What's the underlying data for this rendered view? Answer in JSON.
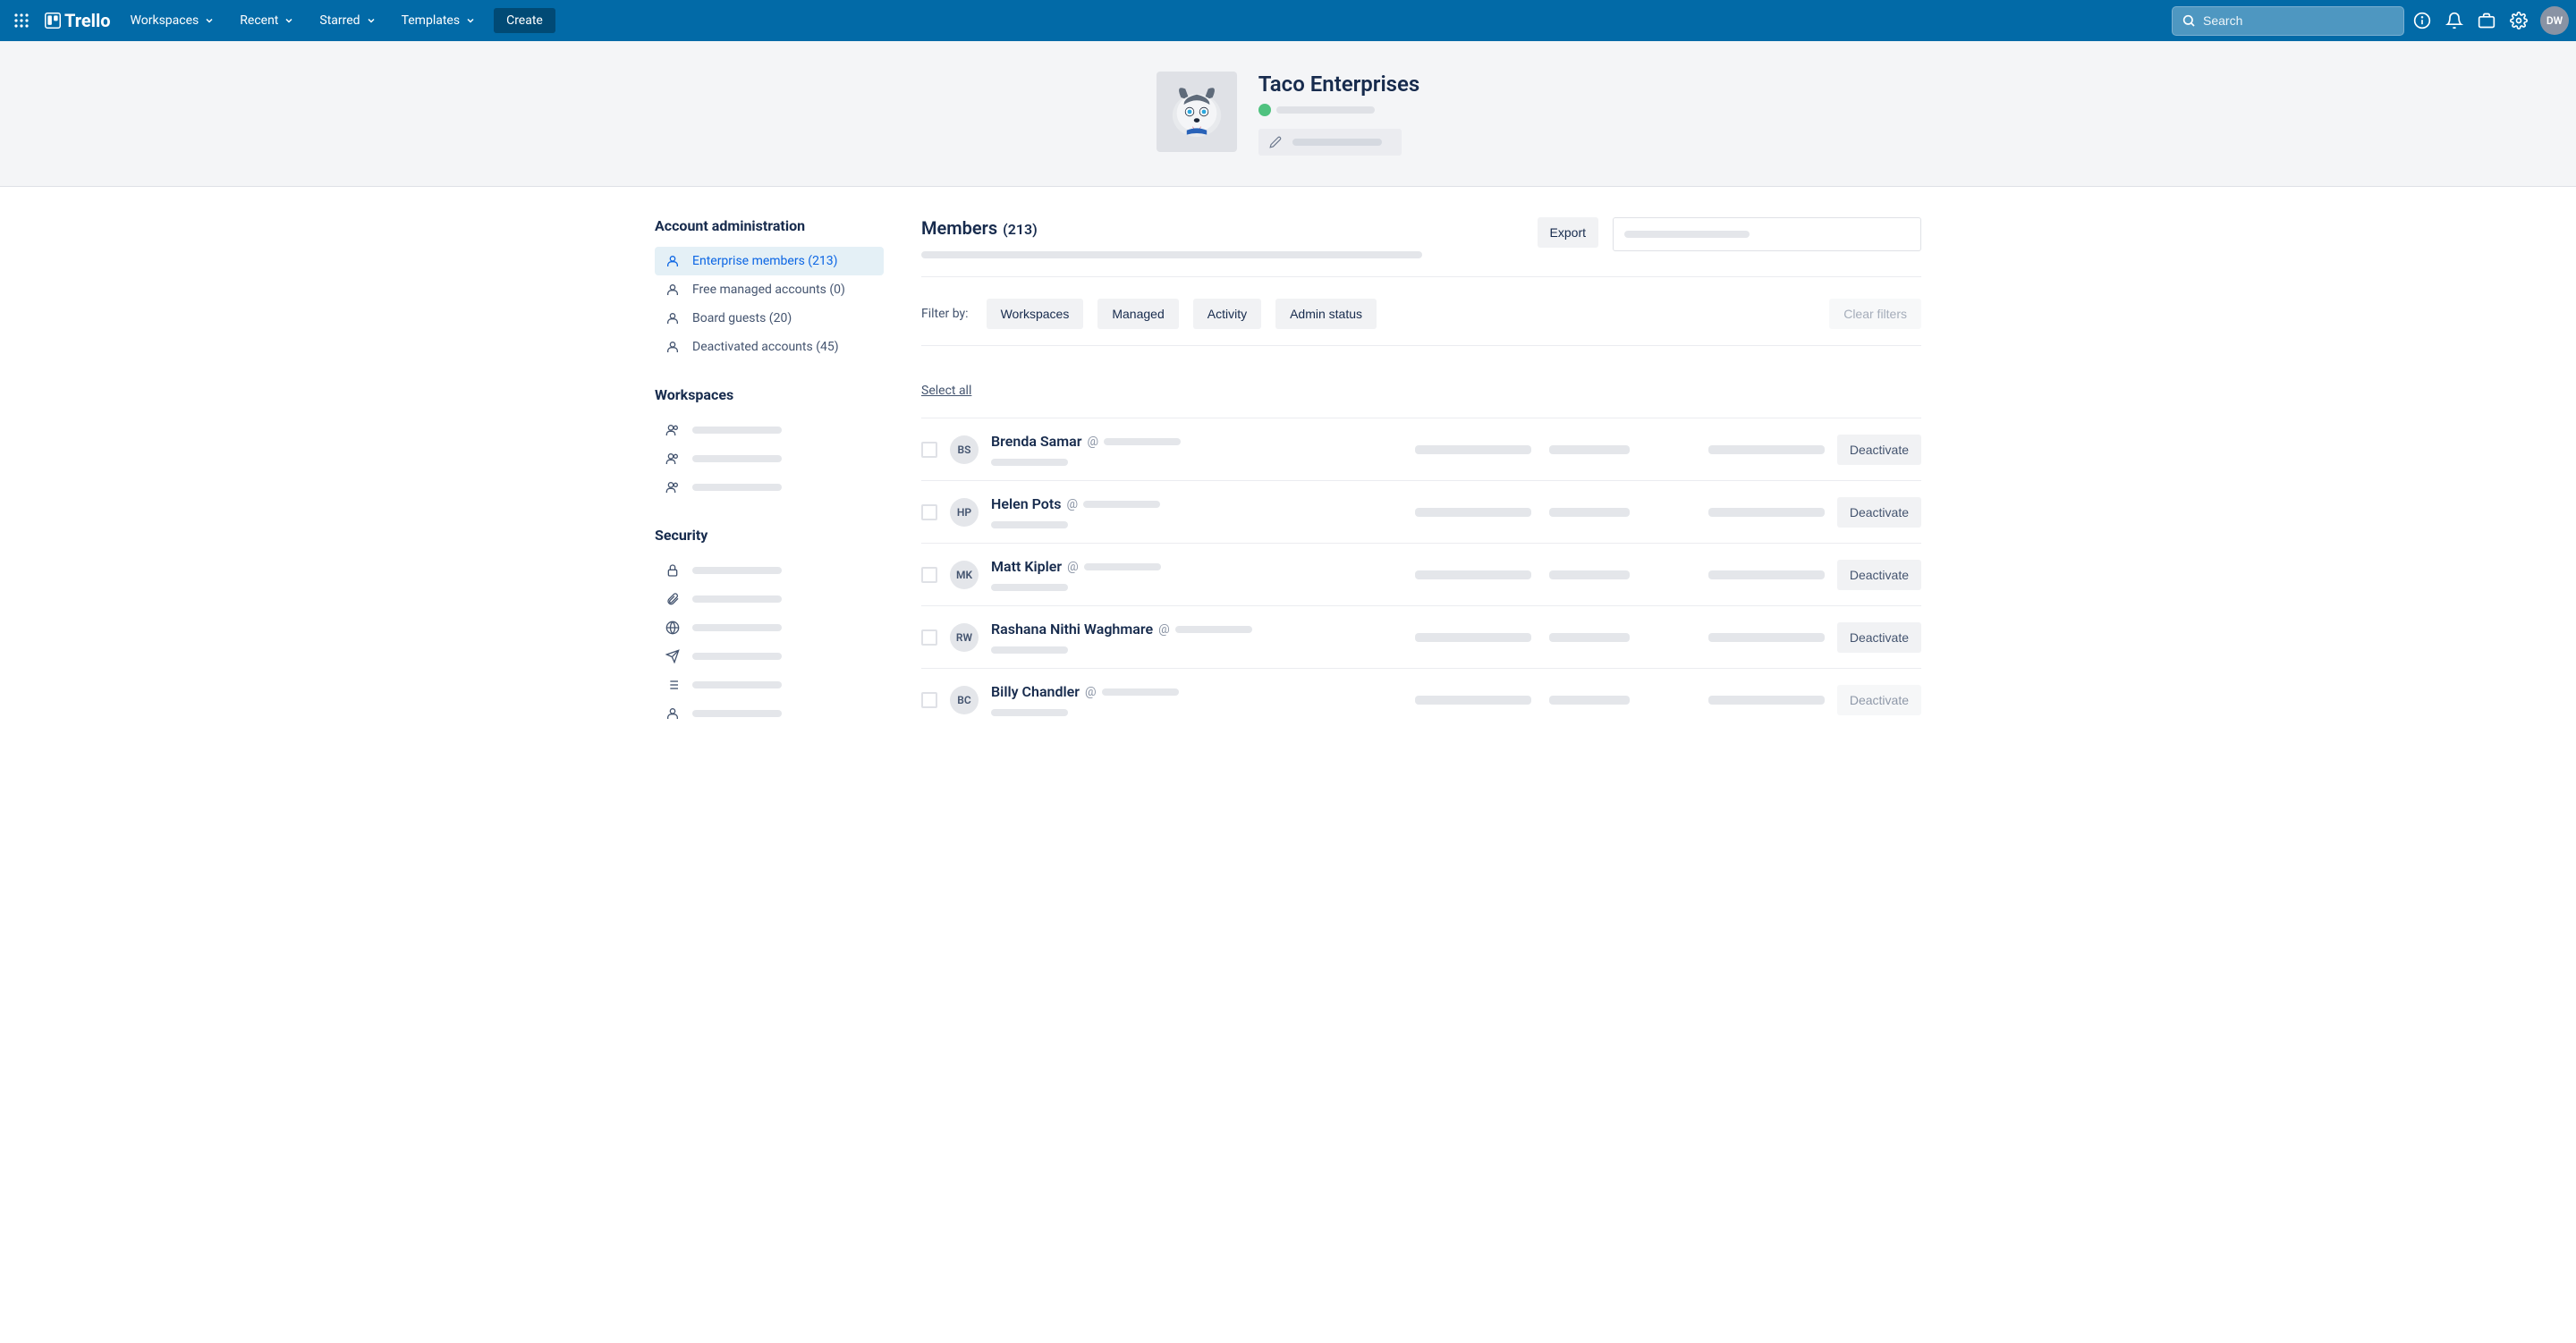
{
  "topnav": {
    "logo": "Trello",
    "items": [
      "Workspaces",
      "Recent",
      "Starred",
      "Templates"
    ],
    "create": "Create",
    "search_placeholder": "Search",
    "avatar_initials": "DW"
  },
  "header": {
    "org_name": "Taco Enterprises"
  },
  "sidebar": {
    "section_admin": "Account administration",
    "admin_items": [
      {
        "label": "Enterprise members (213)",
        "active": true
      },
      {
        "label": "Free managed accounts (0)",
        "active": false
      },
      {
        "label": "Board guests (20)",
        "active": false
      },
      {
        "label": "Deactivated accounts (45)",
        "active": false
      }
    ],
    "section_workspaces": "Workspaces",
    "section_security": "Security"
  },
  "main": {
    "title": "Members",
    "count": "(213)",
    "export": "Export",
    "filter_label": "Filter by:",
    "filters": [
      "Workspaces",
      "Managed",
      "Activity",
      "Admin status"
    ],
    "clear_filters": "Clear filters",
    "select_all": "Select all",
    "deactivate_label": "Deactivate",
    "members": [
      {
        "initials": "BS",
        "name": "Brenda Samar"
      },
      {
        "initials": "HP",
        "name": "Helen Pots"
      },
      {
        "initials": "MK",
        "name": "Matt Kipler"
      },
      {
        "initials": "RW",
        "name": "Rashana Nithi Waghmare"
      },
      {
        "initials": "BC",
        "name": "Billy Chandler"
      }
    ]
  }
}
